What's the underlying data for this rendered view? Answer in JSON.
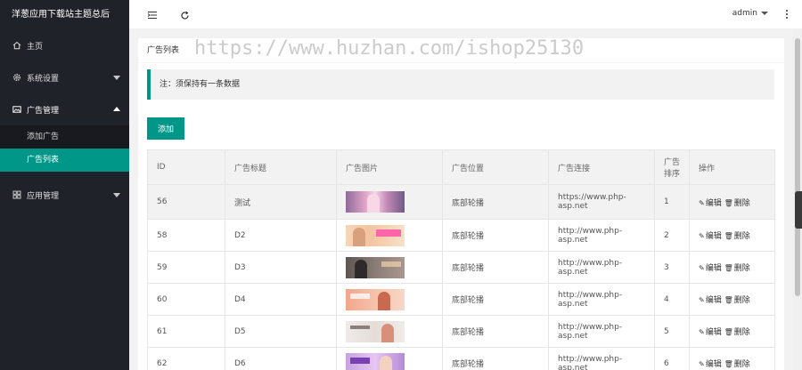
{
  "sidebar": {
    "brand": "洋葱应用下载站主题总后",
    "items": [
      {
        "label": "主页",
        "icon": "home-icon"
      },
      {
        "label": "系统设置",
        "icon": "gear-icon"
      },
      {
        "label": "广告管理",
        "icon": "image-icon"
      },
      {
        "label": "应用管理",
        "icon": "apps-icon"
      }
    ],
    "ad_sub": [
      {
        "label": "添加广告"
      },
      {
        "label": "广告列表"
      }
    ]
  },
  "header": {
    "user": "admin",
    "icons": [
      "menu-toggle-icon",
      "refresh-icon",
      "more-vertical-icon"
    ]
  },
  "card": {
    "title": "广告列表",
    "notice": "注：须保持有一条数据",
    "add_label": "添加"
  },
  "table": {
    "headers": [
      "ID",
      "广告标题",
      "广告图片",
      "广告位置",
      "广告连接",
      "广告排序",
      "操作"
    ],
    "rows": [
      {
        "id": "56",
        "title": "测试",
        "position": "底部轮播",
        "link": "https://www.php-asp.net",
        "sort": "1"
      },
      {
        "id": "58",
        "title": "D2",
        "position": "底部轮播",
        "link": "http://www.php-asp.net",
        "sort": "2"
      },
      {
        "id": "59",
        "title": "D3",
        "position": "底部轮播",
        "link": "http://www.php-asp.net",
        "sort": "3"
      },
      {
        "id": "60",
        "title": "D4",
        "position": "底部轮播",
        "link": "http://www.php-asp.net",
        "sort": "4"
      },
      {
        "id": "61",
        "title": "D5",
        "position": "底部轮播",
        "link": "http://www.php-asp.net",
        "sort": "5"
      },
      {
        "id": "62",
        "title": "D6",
        "position": "底部轮播",
        "link": "http://www.php-asp.net",
        "sort": "6"
      }
    ],
    "edit_label": "编辑",
    "delete_label": "删除"
  },
  "watermark": "https://www.huzhan.com/ishop25130",
  "colors": {
    "accent": "#009688",
    "sidebar_bg": "#20222a",
    "subnav_bg": "#191a20",
    "thumbs": [
      "#c9a0c8",
      "#f3c7a8",
      "#7a6e68",
      "#f0b8a0",
      "#ece6e4",
      "#c9a2e0"
    ]
  }
}
